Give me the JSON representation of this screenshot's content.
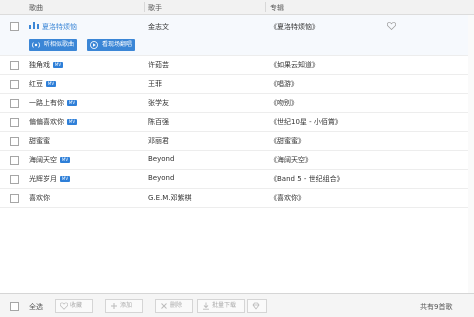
{
  "header": {
    "song_col": "歌曲",
    "artist_col": "歌手",
    "album_col": "专辑"
  },
  "playing": {
    "name": "夏洛特烦恼",
    "artist": "金志文",
    "album": "《夏洛特烦恼》",
    "listen_similar": "听相似歌曲",
    "watch_live": "看现场翻唱"
  },
  "songs": [
    {
      "name": "独角戏",
      "artist": "许茹芸",
      "album": "《如果云知道》",
      "mv": "MV"
    },
    {
      "name": "红豆",
      "artist": "王菲",
      "album": "《唱游》",
      "mv": "MV"
    },
    {
      "name": "一路上有你",
      "artist": "张学友",
      "album": "《吻别》",
      "mv": "MV"
    },
    {
      "name": "偏偏喜欢你",
      "artist": "陈百强",
      "album": "《世纪10星 - 小佰賞》",
      "mv": "MV"
    },
    {
      "name": "甜蜜蜜",
      "artist": "邓丽君",
      "album": "《甜蜜蜜》",
      "mv": ""
    },
    {
      "name": "海阔天空",
      "artist": "Beyond",
      "album": "《海阔天空》",
      "mv": "MV"
    },
    {
      "name": "光辉岁月",
      "artist": "Beyond",
      "album": "《Band 5 - 世纪组合》",
      "mv": "MV"
    },
    {
      "name": "喜欢你",
      "artist": "G.E.M.邓紫棋",
      "album": "《喜欢你》",
      "mv": ""
    }
  ],
  "footer": {
    "select_all": "全选",
    "favorite": "收藏",
    "add": "添加",
    "delete": "删除",
    "batch_download": "批量下载",
    "count": "共有9首歌"
  },
  "colors": {
    "accent": "#3b86d6",
    "mv_badge": "#2e7fd8"
  }
}
